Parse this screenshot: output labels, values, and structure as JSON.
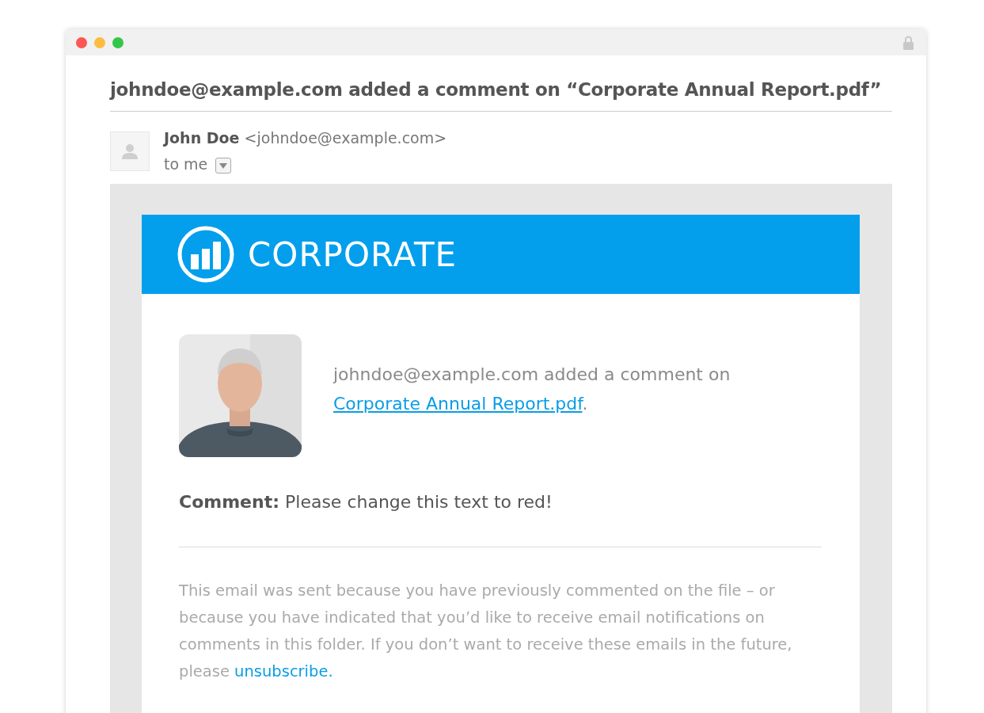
{
  "email": {
    "subject": "johndoe@example.com added a comment on “Corporate Annual Report.pdf”",
    "sender": {
      "name": "John Doe",
      "address": "<johndoe@example.com>"
    },
    "recipient": "to me",
    "body": {
      "brand": "CORPORATE",
      "notification": {
        "text": "johndoe@example.com added a comment on",
        "link": "Corporate Annual Report.pdf",
        "end": "."
      },
      "comment": "**Comment:** Please change this text to red!",
      "footer": {
        "text": "This email was sent because you have previously commented on the file – or because you have indicated that you’d like to receive email notifications on comments in this folder. If you don’t want to receive these emails in the future, please",
        "link": "unsubscribe."
      }
    }
  }
}
